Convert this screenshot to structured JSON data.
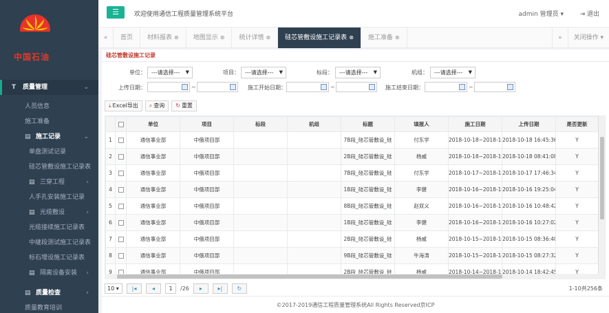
{
  "app": {
    "logo_text": "中国石油",
    "welcome": "欢迎使用通信工程质量管理系统平台",
    "user": "admin 管理员",
    "logout": "退出"
  },
  "sidebar": {
    "section_main": "质量管理",
    "items": [
      {
        "label": "人员信息",
        "level": 1
      },
      {
        "label": "施工准备",
        "level": 1
      }
    ],
    "group_construction": "施工记录",
    "construction_items": [
      {
        "label": "单盘测试记录",
        "level": 2
      },
      {
        "label": "硅芯管敷设施工记录表",
        "level": 2
      },
      {
        "label": "三穿工程",
        "level": 2,
        "has_children": true
      },
      {
        "label": "人手孔安装施工记录",
        "level": 2
      },
      {
        "label": "光缆敷设",
        "level": 2,
        "has_children": true
      },
      {
        "label": "光缆接续施工记录表",
        "level": 2
      },
      {
        "label": "中継段测试施工记录表",
        "level": 2
      },
      {
        "label": "标石埋设施工记录表",
        "level": 2
      },
      {
        "label": "隔离设备安装",
        "level": 2,
        "has_children": true
      }
    ],
    "section_check": "质量检查",
    "section_training": "质量教育培训"
  },
  "tabs": {
    "items": [
      {
        "label": "首页",
        "active": false,
        "closable": false
      },
      {
        "label": "材料报表",
        "active": false,
        "closable": true
      },
      {
        "label": "地图显示",
        "active": false,
        "closable": true
      },
      {
        "label": "统计详情",
        "active": false,
        "closable": true
      },
      {
        "label": "硅芯管敷设施工记录表",
        "active": true,
        "closable": true
      },
      {
        "label": "施工准备",
        "active": false,
        "closable": true
      }
    ],
    "close_ops": "关闭操作"
  },
  "panel": {
    "title": "硅芯管敷设施工记录"
  },
  "filters": {
    "unit_label": "单位：",
    "project_label": "项目：",
    "section_label": "标段：",
    "machine_label": "机组：",
    "select_placeholder": "---请选择---",
    "upload_date_label": "上传日期：",
    "start_date_label": "施工开始日期：",
    "end_date_label": "施工结束日期：",
    "tilde": "~"
  },
  "toolbar": {
    "excel": "Excel导出",
    "query": "查询",
    "reset": "重置"
  },
  "table": {
    "columns": [
      "",
      "单位",
      "项目",
      "标段",
      "机组",
      "标题",
      "填报人",
      "施工日期",
      "上传日期",
      "是否更新"
    ],
    "rows": [
      {
        "no": "1",
        "unit": "通信事业部",
        "project": "中俄项目部",
        "section": "",
        "machine": "",
        "title": "7B段_硅芯管敷设_硅",
        "reporter": "付东学",
        "build_date": "2018-10-18~2018-10-",
        "upload": "2018-10-18 16:45:36",
        "updated": "Y"
      },
      {
        "no": "2",
        "unit": "通信事业部",
        "project": "中俄项目部",
        "section": "",
        "machine": "",
        "title": "2B段_硅芯管敷设_硅",
        "reporter": "杨威",
        "build_date": "2018-10-18~2018-10-",
        "upload": "2018-10-18 08:41:08",
        "updated": "Y"
      },
      {
        "no": "3",
        "unit": "通信事业部",
        "project": "中俄项目部",
        "section": "",
        "machine": "",
        "title": "7B段_硅芯管敷设_硅",
        "reporter": "付东学",
        "build_date": "2018-10-17~2018-10-",
        "upload": "2018-10-17 17:46:34",
        "updated": "Y"
      },
      {
        "no": "4",
        "unit": "通信事业部",
        "project": "中俄项目部",
        "section": "",
        "machine": "",
        "title": "1B段_硅芯管敷设_硅",
        "reporter": "李健",
        "build_date": "2018-10-16~2018-10-",
        "upload": "2018-10-16 19:25:04",
        "updated": "Y"
      },
      {
        "no": "5",
        "unit": "通信事业部",
        "project": "中俄项目部",
        "section": "",
        "machine": "",
        "title": "8B段_硅芯管敷设_硅",
        "reporter": "赵双义",
        "build_date": "2018-10-16~2018-10-",
        "upload": "2018-10-16 10:48:42",
        "updated": "Y"
      },
      {
        "no": "6",
        "unit": "通信事业部",
        "project": "中俄项目部",
        "section": "",
        "machine": "",
        "title": "1B段_硅芯管敷设_硅",
        "reporter": "李健",
        "build_date": "2018-10-16~2018-10-",
        "upload": "2018-10-16 10:27:02",
        "updated": "Y"
      },
      {
        "no": "7",
        "unit": "通信事业部",
        "project": "中俄项目部",
        "section": "",
        "machine": "",
        "title": "2B段_硅芯管敷设_硅",
        "reporter": "杨威",
        "build_date": "2018-10-15~2018-10-",
        "upload": "2018-10-15 08:36:40",
        "updated": "Y"
      },
      {
        "no": "8",
        "unit": "通信事业部",
        "project": "中俄项目部",
        "section": "",
        "machine": "",
        "title": "9B段_硅芯管敷设_硅",
        "reporter": "牛海涛",
        "build_date": "2018-10-15~2018-10-",
        "upload": "2018-10-15 08:27:32",
        "updated": "Y"
      },
      {
        "no": "9",
        "unit": "通信事业部",
        "project": "中俄项目部",
        "section": "",
        "machine": "",
        "title": "2B段_硅芯管敷设_硅",
        "reporter": "杨威",
        "build_date": "2018-10-14~2018-10-",
        "upload": "2018-10-14 18:42:45",
        "updated": "Y"
      }
    ]
  },
  "pager": {
    "page_size": "10",
    "current_page": "1",
    "total_pages": "/26",
    "info": "1-10共256条"
  },
  "footer": {
    "text": "©2017-2019通信工程质量管理系统All Rights Reserved京ICP"
  },
  "colors": {
    "sidebar_bg": "#2f4050",
    "accent": "#1ab394",
    "active_tab": "#2f4050",
    "title_red": "#c0392b"
  }
}
